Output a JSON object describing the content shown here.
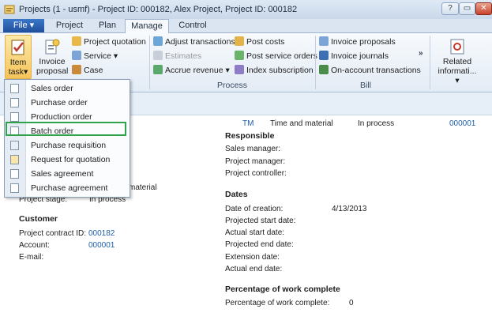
{
  "window": {
    "title": "Projects (1 - usmf) - Project ID: 000182, Alex Project, Project ID: 000182",
    "help_label": "?",
    "minimize_label": "▭",
    "close_label": "✕"
  },
  "tabs": {
    "file": "File ▾",
    "project": "Project",
    "plan": "Plan",
    "manage": "Manage",
    "control": "Control"
  },
  "ribbon": {
    "item_task": {
      "line1": "Item",
      "line2": "task▾"
    },
    "invoice_proposal": {
      "line1": "Invoice",
      "line2": "proposal"
    },
    "project_quotation": "Project quotation",
    "service": "Service ▾",
    "case": "Case",
    "adjust_transactions": "Adjust transactions",
    "estimates": "Estimates",
    "accrue_revenue": "Accrue revenue ▾",
    "post_costs": "Post costs",
    "post_service_orders": "Post service orders",
    "index_subscription": "Index subscription",
    "invoice_proposals": "Invoice proposals",
    "invoice_journals": "Invoice journals",
    "on_account_transactions": "On-account transactions",
    "related_info": {
      "line1": "Related",
      "line2": "informati...",
      "line3": "▾"
    },
    "more": "»",
    "groups": {
      "process": "Process",
      "bill": "Bill"
    }
  },
  "dropdown": {
    "items": [
      "Sales order",
      "Purchase order",
      "Production order",
      "Batch order",
      "Purchase requisition",
      "Request for quotation",
      "Sales agreement",
      "Purchase agreement"
    ],
    "highlighted": "Batch order"
  },
  "row": {
    "code": "TM",
    "type": "Time and material",
    "status": "In process",
    "id": "000001"
  },
  "left": {
    "partial_value": "material",
    "project_stage_label": "Project stage:",
    "project_stage_value": "In process",
    "customer_heading": "Customer",
    "contract_label": "Project contract ID:",
    "contract_value": "000182",
    "account_label": "Account:",
    "account_value": "000001",
    "email_label": "E-mail:"
  },
  "responsible": {
    "heading": "Responsible",
    "sales_manager": "Sales manager:",
    "project_manager": "Project manager:",
    "project_controller": "Project controller:"
  },
  "dates": {
    "heading": "Dates",
    "creation_label": "Date of creation:",
    "creation_value": "4/13/2013",
    "proj_start": "Projected start date:",
    "actual_start": "Actual start date:",
    "proj_end": "Projected end date:",
    "extension": "Extension date:",
    "actual_end": "Actual end date:"
  },
  "percentage": {
    "heading": "Percentage of work complete",
    "label": "Percentage of work complete:",
    "value": "0"
  },
  "colors": {
    "accent": "#1f5ea8",
    "highlight_border": "#2fa24a",
    "file_tab": "#2a61b5"
  }
}
